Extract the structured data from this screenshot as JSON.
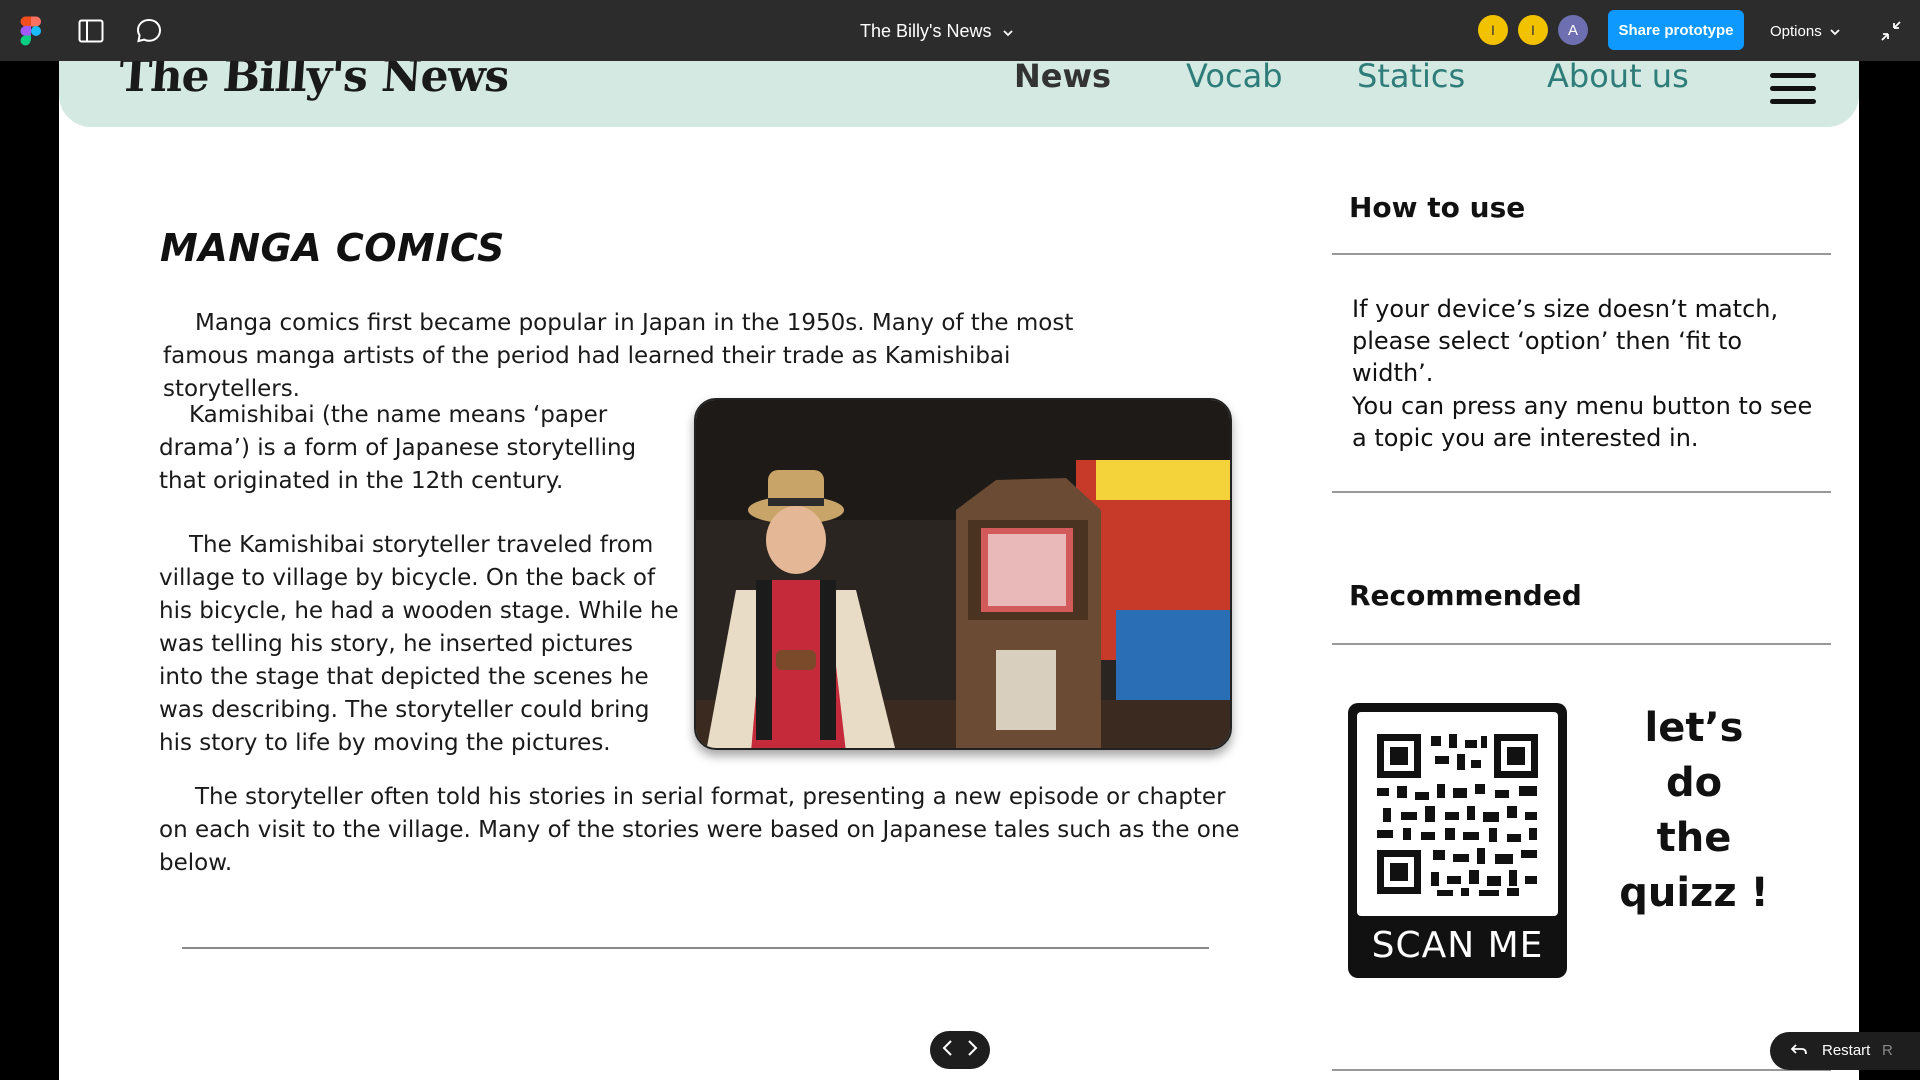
{
  "toolbar": {
    "file_title": "The Billy's News",
    "share_label": "Share prototype",
    "options_label": "Options",
    "avatars": [
      "I",
      "I",
      "A"
    ],
    "colors": {
      "bar": "#2c2c2c",
      "share": "#0d99ff",
      "avatar_yellow": "#f2c200",
      "avatar_a": "#6d6fb0"
    }
  },
  "site": {
    "logo": "The Billy's News",
    "nav": [
      "News",
      "Vocab",
      "Statics",
      "About us"
    ],
    "header_color": "#d3e9e1"
  },
  "article": {
    "title": "MANGA COMICS",
    "paragraphs": [
      "Manga comics first became popular in Japan in the 1950s. Many of the most famous manga artists of the period had learned their trade as Kamishibai storytellers.",
      "Kamishibai (the name means ‘paper drama’) is a form of Japanese storytelling that originated in the 12th century.",
      "The Kamishibai storyteller traveled from village to village by bicycle. On the back of his bicycle, he had a wooden stage. While he was telling his story, he inserted pictures into the stage that depicted the scenes he was describing. The storyteller could bring his story to life by moving the pictures.",
      "The storyteller often told his stories in serial format, presenting a new episode or chapter on each visit to the village. Many of the stories were based on Japanese tales such as the one below."
    ]
  },
  "sidebar": {
    "how_heading": "How to use",
    "how_text": [
      "If your device’s size doesn’t match, please select ‘option’ then ‘fit to width’.",
      "You can press any menu button to see a topic you are interested in."
    ],
    "recommended_heading": "Recommended",
    "qr_caption": "SCAN ME",
    "quiz_lines": [
      "let’s",
      "do",
      "the",
      "quizz !"
    ]
  },
  "player": {
    "restart_label": "Restart",
    "restart_key": "R"
  }
}
